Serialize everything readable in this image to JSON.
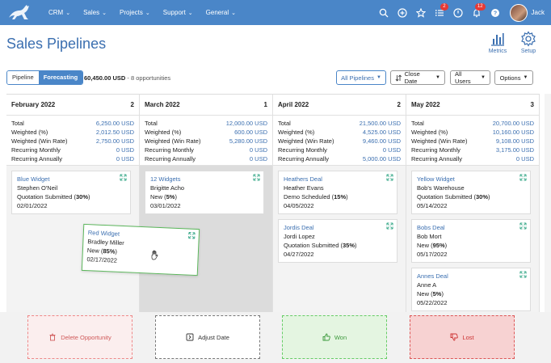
{
  "nav": {
    "items": [
      {
        "label": "CRM"
      },
      {
        "label": "Sales"
      },
      {
        "label": "Projects"
      },
      {
        "label": "Support"
      },
      {
        "label": "General"
      }
    ],
    "badges": {
      "tasks": "2",
      "notifications": "12"
    },
    "user": "Jack"
  },
  "header": {
    "title": "Sales Pipelines",
    "metrics_label": "Metrics",
    "setup_label": "Setup"
  },
  "toolbar": {
    "pipeline_tab": "Pipeline",
    "forecasting_tab": "Forecasting",
    "total": "60,450.00 USD",
    "opportunities": " - 8 opportunities",
    "all_pipelines": "All Pipelines",
    "close_date": "Close Date",
    "all_users": "All Users",
    "options": "Options"
  },
  "stat_labels": [
    "Total",
    "Weighted (%)",
    "Weighted (Win Rate)",
    "Recurring Monthly",
    "Recurring Annually"
  ],
  "columns": [
    {
      "month": "February 2022",
      "count": "2",
      "stats": [
        "6,250.00 USD",
        "2,012.50 USD",
        "2,750.00 USD",
        "0 USD",
        "0 USD"
      ],
      "cards": [
        {
          "name": "Blue Widget",
          "contact": "Stephen O'Neil",
          "stage": "Quotation Submitted",
          "pct": "30%",
          "date": "02/01/2022"
        }
      ]
    },
    {
      "month": "March 2022",
      "count": "1",
      "stats": [
        "12,000.00 USD",
        "600.00 USD",
        "5,280.00 USD",
        "0 USD",
        "0 USD"
      ],
      "cards": [
        {
          "name": "12 Widgets",
          "contact": "Brigitte Acho",
          "stage": "New",
          "pct": "5%",
          "date": "03/01/2022"
        }
      ]
    },
    {
      "month": "April 2022",
      "count": "2",
      "stats": [
        "21,500.00 USD",
        "4,525.00 USD",
        "9,460.00 USD",
        "0 USD",
        "5,000.00 USD"
      ],
      "cards": [
        {
          "name": "Heathers Deal",
          "contact": "Heather Evans",
          "stage": "Demo Scheduled",
          "pct": "15%",
          "date": "04/05/2022"
        },
        {
          "name": "Jordis Deal",
          "contact": "Jordi Lopez",
          "stage": "Quotation Submitted",
          "pct": "35%",
          "date": "04/27/2022"
        }
      ]
    },
    {
      "month": "May 2022",
      "count": "3",
      "stats": [
        "20,700.00 USD",
        "10,160.00 USD",
        "9,108.00 USD",
        "3,175.00 USD",
        "0 USD"
      ],
      "cards": [
        {
          "name": "Yellow Widget",
          "contact": "Bob's Warehouse",
          "stage": "Quotation Submitted",
          "pct": "30%",
          "date": "05/14/2022"
        },
        {
          "name": "Bobs Deal",
          "contact": "Bob Mort",
          "stage": "New",
          "pct": "95%",
          "date": "05/17/2022"
        },
        {
          "name": "Annes Deal",
          "contact": "Anne A",
          "stage": "New",
          "pct": "5%",
          "date": "05/22/2022"
        }
      ]
    }
  ],
  "dragging": {
    "name": "Red Widget",
    "contact": "Bradley Miller",
    "stage": "New",
    "pct": "85%",
    "date": "02/17/2022"
  },
  "dropzones": {
    "delete": "Delete Opportunity",
    "adjust": "Adjust Date",
    "won": "Won",
    "lost": "Lost"
  }
}
